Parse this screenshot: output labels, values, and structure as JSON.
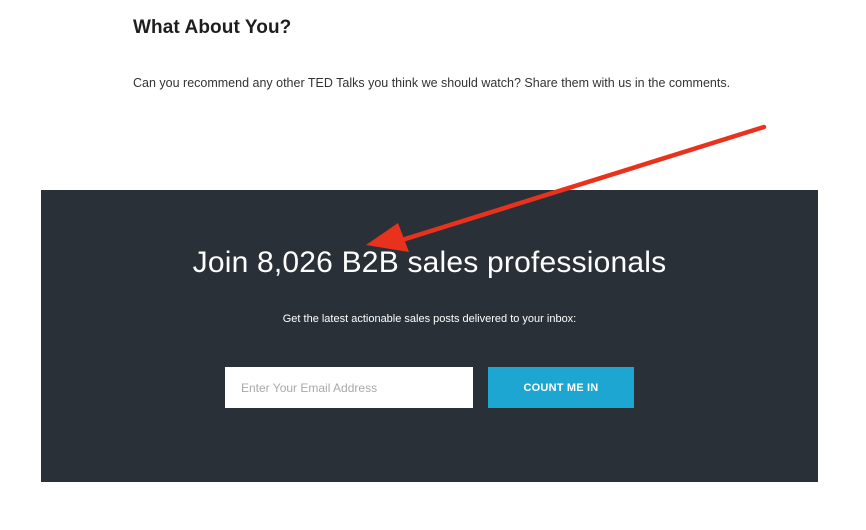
{
  "article": {
    "heading": "What About You?",
    "body": "Can you recommend any other TED Talks you think we should watch? Share them with us in the comments."
  },
  "signup": {
    "headline": "Join 8,026 B2B sales professionals",
    "subline": "Get the latest actionable sales posts delivered to your inbox:",
    "email_value": "",
    "email_placeholder": "Enter Your Email Address",
    "button_label": "COUNT ME IN"
  },
  "colors": {
    "panel_background": "#2a3038",
    "button_background": "#1ea6d3",
    "annotation_arrow": "#e8321e"
  },
  "icons": {
    "annotation": "red-arrow-icon"
  }
}
